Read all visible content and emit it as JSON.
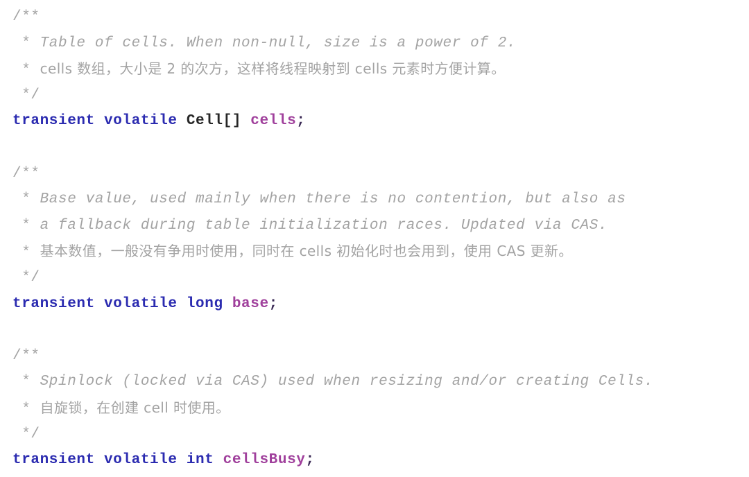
{
  "editor": {
    "language": "java",
    "background_color": "#ffffff",
    "comment_color": "#a3a3a3",
    "keyword_color": "#2b2bb0",
    "type_color": "#262626",
    "identifier_color": "#a0409c",
    "punctuation_color": "#3b2a55"
  },
  "code": {
    "blocks": [
      {
        "comment": {
          "open": "/**",
          "lines": [
            {
              "bullet": " * ",
              "text": "Table of cells. When non-null, size is a power of 2.",
              "script": "latin"
            },
            {
              "bullet": " * ",
              "text": "cells 数组，大小是 2 的次方，这样将线程映射到 cells 元素时方便计算。",
              "script": "cjk"
            }
          ],
          "close": " */"
        },
        "declaration": {
          "keywords": "transient volatile",
          "type": "Cell[]",
          "identifier": "cells",
          "terminator": ";"
        }
      },
      {
        "comment": {
          "open": "/**",
          "lines": [
            {
              "bullet": " * ",
              "text": "Base value, used mainly when there is no contention, but also as",
              "script": "latin"
            },
            {
              "bullet": " * ",
              "text": "a fallback during table initialization races. Updated via CAS.",
              "script": "latin"
            },
            {
              "bullet": " * ",
              "text": "基本数值，一般没有争用时使用，同时在 cells 初始化时也会用到，使用 CAS 更新。",
              "script": "cjk"
            }
          ],
          "close": " */"
        },
        "declaration": {
          "keywords": "transient volatile long",
          "type": "",
          "identifier": "base",
          "terminator": ";"
        }
      },
      {
        "comment": {
          "open": "/**",
          "lines": [
            {
              "bullet": " * ",
              "text": "Spinlock (locked via CAS) used when resizing and/or creating Cells.",
              "script": "latin"
            },
            {
              "bullet": " * ",
              "text": "自旋锁，在创建 cell 时使用。",
              "script": "cjk"
            }
          ],
          "close": " */"
        },
        "declaration": {
          "keywords": "transient volatile int",
          "type": "",
          "identifier": "cellsBusy",
          "terminator": ";"
        }
      }
    ]
  }
}
